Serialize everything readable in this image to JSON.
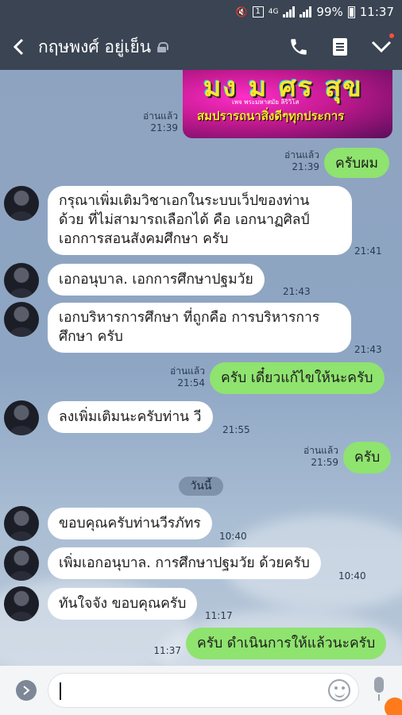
{
  "status_bar": {
    "battery": "99%",
    "time": "11:37",
    "network": "4G"
  },
  "header": {
    "title": "กฤษพงศ์ อยู่เย็น"
  },
  "image_message": {
    "big_text": "มง ม ศร สุข",
    "sub_text": "สมปรารถนาสิ่งดีๆทุกประการ",
    "tiny_text": "เพจ พระมหาสมัย ลิริวิโส",
    "read": "อ่านแล้ว",
    "time": "21:39"
  },
  "messages": [
    {
      "dir": "out",
      "text": "ครับผม",
      "read": "อ่านแล้ว",
      "time": "21:39"
    },
    {
      "dir": "in",
      "lines": [
        "กรุณาเพิ่มเติมวิชาเอกในระบบเว็ปของท่าน",
        "ด้วย ที่ไม่สามารถเลือกได้ คือ เอกนาฏศิลป์",
        "เอกการสอนสังคมศึกษา ครับ"
      ],
      "time": "21:41"
    },
    {
      "dir": "in",
      "text": "เอกอนุบาล. เอกการศึกษาปฐมวัย",
      "time": "21:43"
    },
    {
      "dir": "in",
      "lines": [
        "เอกบริหารการศึกษา ที่ถูกคือ การบริหารการ",
        "ศึกษา ครับ"
      ],
      "time": "21:43"
    },
    {
      "dir": "out",
      "text": "ครับ เดี๋ยวแก้ไขให้นะครับ",
      "read": "อ่านแล้ว",
      "time": "21:54"
    },
    {
      "dir": "in",
      "text": "ลงเพิ่มเติมนะครับท่าน วี",
      "time": "21:55"
    },
    {
      "dir": "out",
      "text": "ครับ",
      "read": "อ่านแล้ว",
      "time": "21:59"
    },
    {
      "dir": "in",
      "text": "ขอบคุณครับท่านวีรภัทร",
      "time": "10:40"
    },
    {
      "dir": "in",
      "text": "เพิ่มเอกอนุบาล. การศึกษาปฐมวัย ด้วยครับ",
      "time": "10:40"
    },
    {
      "dir": "in",
      "text": "ทันใจจัง ขอบคุณครับ",
      "time": "11:17"
    },
    {
      "dir": "out",
      "text": "ครับ ดำเนินการให้แล้วนะครับ",
      "time": "11:37"
    }
  ],
  "date_separator": "วันนี้",
  "icons": {
    "back": "back-arrow-icon",
    "call": "phone-icon",
    "notes": "notes-icon",
    "menu": "chevron-down-icon"
  },
  "colors": {
    "header_bg": "#3a4453",
    "bubble_out": "#8fe36f",
    "bubble_in": "#ffffff"
  }
}
